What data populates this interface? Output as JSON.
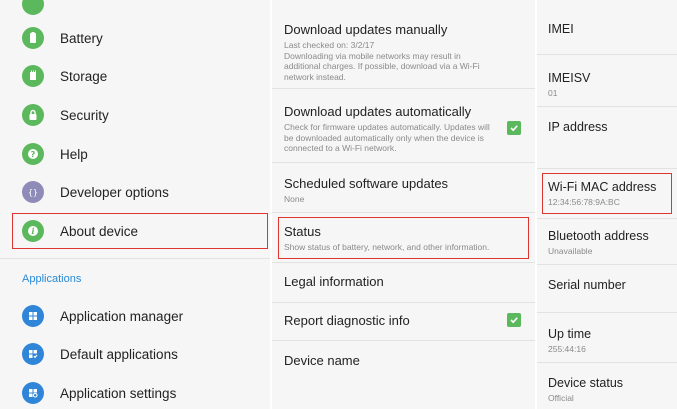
{
  "settings_menu": {
    "items": [
      {
        "label": "Battery",
        "icon": "battery-icon"
      },
      {
        "label": "Storage",
        "icon": "storage-icon"
      },
      {
        "label": "Security",
        "icon": "lock-icon"
      },
      {
        "label": "Help",
        "icon": "help-icon"
      },
      {
        "label": "Developer options",
        "icon": "developer-braces-icon"
      },
      {
        "label": "About device",
        "icon": "info-icon"
      }
    ],
    "section_header": "Applications",
    "app_items": [
      {
        "label": "Application manager",
        "icon": "grid-icon"
      },
      {
        "label": "Default applications",
        "icon": "default-apps-icon"
      },
      {
        "label": "Application settings",
        "icon": "app-settings-icon"
      }
    ]
  },
  "about_device": {
    "rows": [
      {
        "title": "Download updates manually",
        "subtitle": "Last checked on: 3/2/17\nDownloading via mobile networks may result in additional charges. If possible, download via a Wi-Fi network instead."
      },
      {
        "title": "Download updates automatically",
        "subtitle": "Check for firmware updates automatically. Updates will be downloaded automatically only when the device is connected to a Wi-Fi network.",
        "checked": true
      },
      {
        "title": "Scheduled software updates",
        "subtitle": "None"
      },
      {
        "title": "Status",
        "subtitle": "Show status of battery, network, and other information."
      },
      {
        "title": "Legal information"
      },
      {
        "title": "Report diagnostic info",
        "checked": true
      },
      {
        "title": "Device name"
      }
    ]
  },
  "status": {
    "rows": [
      {
        "title": "IMEI"
      },
      {
        "title": "IMEISV",
        "value": "01"
      },
      {
        "title": "IP address"
      },
      {
        "title": "Wi-Fi MAC address",
        "value": "12:34:56:78:9A:BC"
      },
      {
        "title": "Bluetooth address",
        "value": "Unavailable"
      },
      {
        "title": "Serial number"
      },
      {
        "title": "Up time",
        "value": "255:44:16"
      },
      {
        "title": "Device status",
        "value": "Official"
      }
    ]
  },
  "colors": {
    "accent_green": "#5cb85c",
    "highlight_red": "#e0342f",
    "section_blue": "#2a8ad6"
  }
}
